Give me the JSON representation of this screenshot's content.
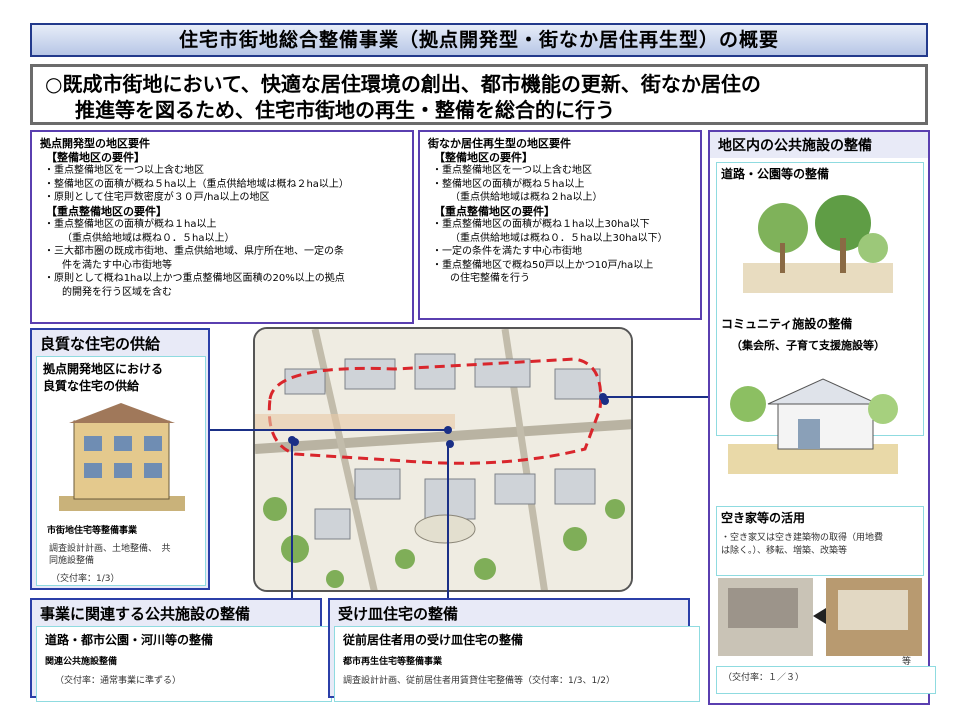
{
  "title": "住宅市街地総合整備事業（拠点開発型・街なか居住再生型）の概要",
  "lead": {
    "line1": "○既成市街地において、快適な居住環境の創出、都市機能の更新、街なか居住の",
    "line2": "推進等を図るため、住宅市街地の再生・整備を総合的に行う"
  },
  "kyoten_requirements": {
    "heading": "拠点開発型の地区要件",
    "sub1": "【整備地区の要件】",
    "items1": [
      "・重点整備地区を一つ以上含む地区",
      "・整備地区の面積が概ね５ha以上（重点供給地域は概ね２ha以上）",
      "・原則として住宅戸数密度が３０戸/ha以上の地区"
    ],
    "sub2": "【重点整備地区の要件】",
    "items2": [
      "・重点整備地区の面積が概ね１ha以上",
      "（重点供給地域は概ね０．５ha以上）",
      "・三大都市圏の既成市街地、重点供給地域、県庁所在地、一定の条",
      "件を満たす中心市街地等",
      "・原則として概ね1ha以上かつ重点整備地区面積の20%以上の拠点",
      "的開発を行う区域を含む"
    ]
  },
  "machinaka_requirements": {
    "heading": "街なか居住再生型の地区要件",
    "sub1": "【整備地区の要件】",
    "items1": [
      "・重点整備地区を一つ以上含む地区",
      "・整備地区の面積が概ね５ha以上",
      "（重点供給地域は概ね２ha以上）"
    ],
    "sub2": "【重点整備地区の要件】",
    "items2": [
      "・重点整備地区の面積が概ね１ha以上30ha以下",
      "（重点供給地域は概ね０．５ha以上30ha以下）",
      "・一定の条件を満たす中心市街地",
      "・重点整備地区で概ね50戸以上かつ10戸/ha以上",
      "の住宅整備を行う"
    ]
  },
  "quality_housing": {
    "heading": "良質な住宅の供給",
    "inner_title1": "拠点開発地区における",
    "inner_title2": "良質な住宅の供給",
    "program": "市街地住宅等整備事業",
    "detail1": "調査設計計画、土地整備、　共",
    "detail2": "同施設整備",
    "rate": "（交付率：1/3）"
  },
  "related_facilities": {
    "heading": "事業に関連する公共施設の整備",
    "item": "道路・都市公園・河川等の整備",
    "program": "関連公共施設整備",
    "rate": "（交付率：通常事業に準ずる）"
  },
  "receiving_housing": {
    "heading": "受け皿住宅の整備",
    "item": "従前居住者用の受け皿住宅の整備",
    "program": "都市再生住宅等整備事業",
    "detail": "調査設計計画、従前居住者用賃貸住宅整備等（交付率：1/3、1/2）"
  },
  "public_facilities": {
    "heading": "地区内の公共施設の整備",
    "road_park": "道路・公園等の整備",
    "community": "コミュニティ施設の整備",
    "community_sub": "（集会所、子育て支援施設等）",
    "vacant": "空き家等の活用",
    "vacant_detail1": "・空き家又は空き建築物の取得（用地費",
    "vacant_detail2": "は除く。）、移転、増築、改築等",
    "etc": "等",
    "rate": "（交付率：１／３）"
  },
  "colors": {
    "panel_border": "#5a3fb0",
    "box_border": "#2b3fa8",
    "box_fill": "#e8eaf7",
    "title_fill": "#b7c6e6",
    "inner_border": "#8fdbe0",
    "red_dash": "#d9262c"
  }
}
